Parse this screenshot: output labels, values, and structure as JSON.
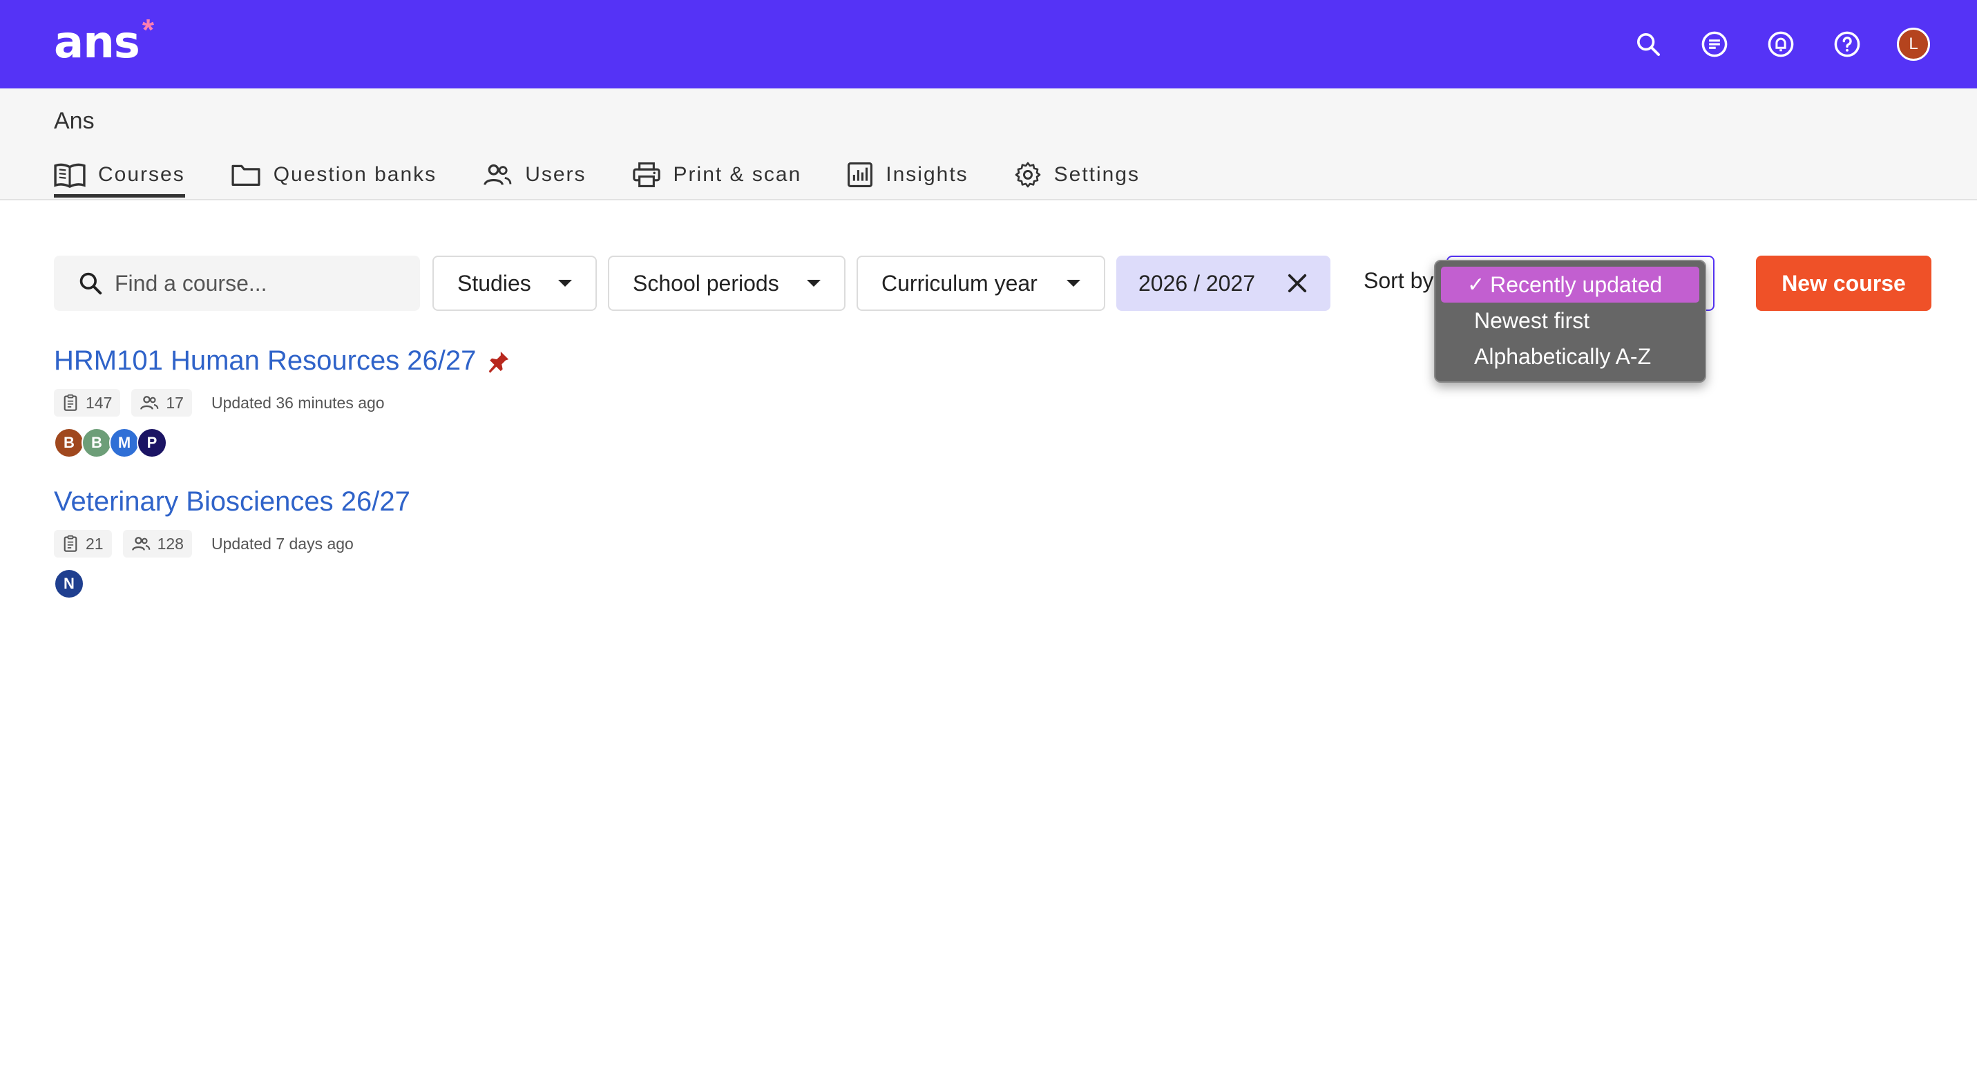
{
  "header": {
    "logo_text": "ans",
    "logo_star": "*",
    "avatar_initial": "L",
    "icons": [
      "search-icon",
      "messages-icon",
      "notifications-icon",
      "help-icon"
    ],
    "brand_color": "#5533f6"
  },
  "org": {
    "name": "Ans"
  },
  "nav": {
    "items": [
      {
        "label": "Courses",
        "icon": "book-icon",
        "active": true
      },
      {
        "label": "Question banks",
        "icon": "folder-icon"
      },
      {
        "label": "Users",
        "icon": "users-icon"
      },
      {
        "label": "Print & scan",
        "icon": "printer-icon"
      },
      {
        "label": "Insights",
        "icon": "chart-icon"
      },
      {
        "label": "Settings",
        "icon": "gear-icon"
      }
    ]
  },
  "filters": {
    "search_placeholder": "Find a course...",
    "studies": "Studies",
    "school_periods": "School periods",
    "curriculum_year": "Curriculum year",
    "year_chip": "2026 / 2027",
    "sort_label": "Sort by",
    "new_course": "New course",
    "accent_color": "#ef5128"
  },
  "sort_options": {
    "selected_check": "✓",
    "items": [
      "Recently updated",
      "Newest first",
      "Alphabetically A-Z"
    ]
  },
  "courses": [
    {
      "title": "HRM101 Human Resources 26/27",
      "pinned": true,
      "assignments": "147",
      "members": "17",
      "updated": "Updated 36 minutes ago",
      "avatars": [
        {
          "initial": "B",
          "color": "#a0481e"
        },
        {
          "initial": "B",
          "color": "#6d9e78"
        },
        {
          "initial": "M",
          "color": "#2f6fd6"
        },
        {
          "initial": "P",
          "color": "#1b1464"
        }
      ]
    },
    {
      "title": "Veterinary Biosciences 26/27",
      "pinned": false,
      "assignments": "21",
      "members": "128",
      "updated": "Updated 7 days ago",
      "avatars": [
        {
          "initial": "N",
          "color": "#1f3f8f"
        }
      ]
    }
  ]
}
